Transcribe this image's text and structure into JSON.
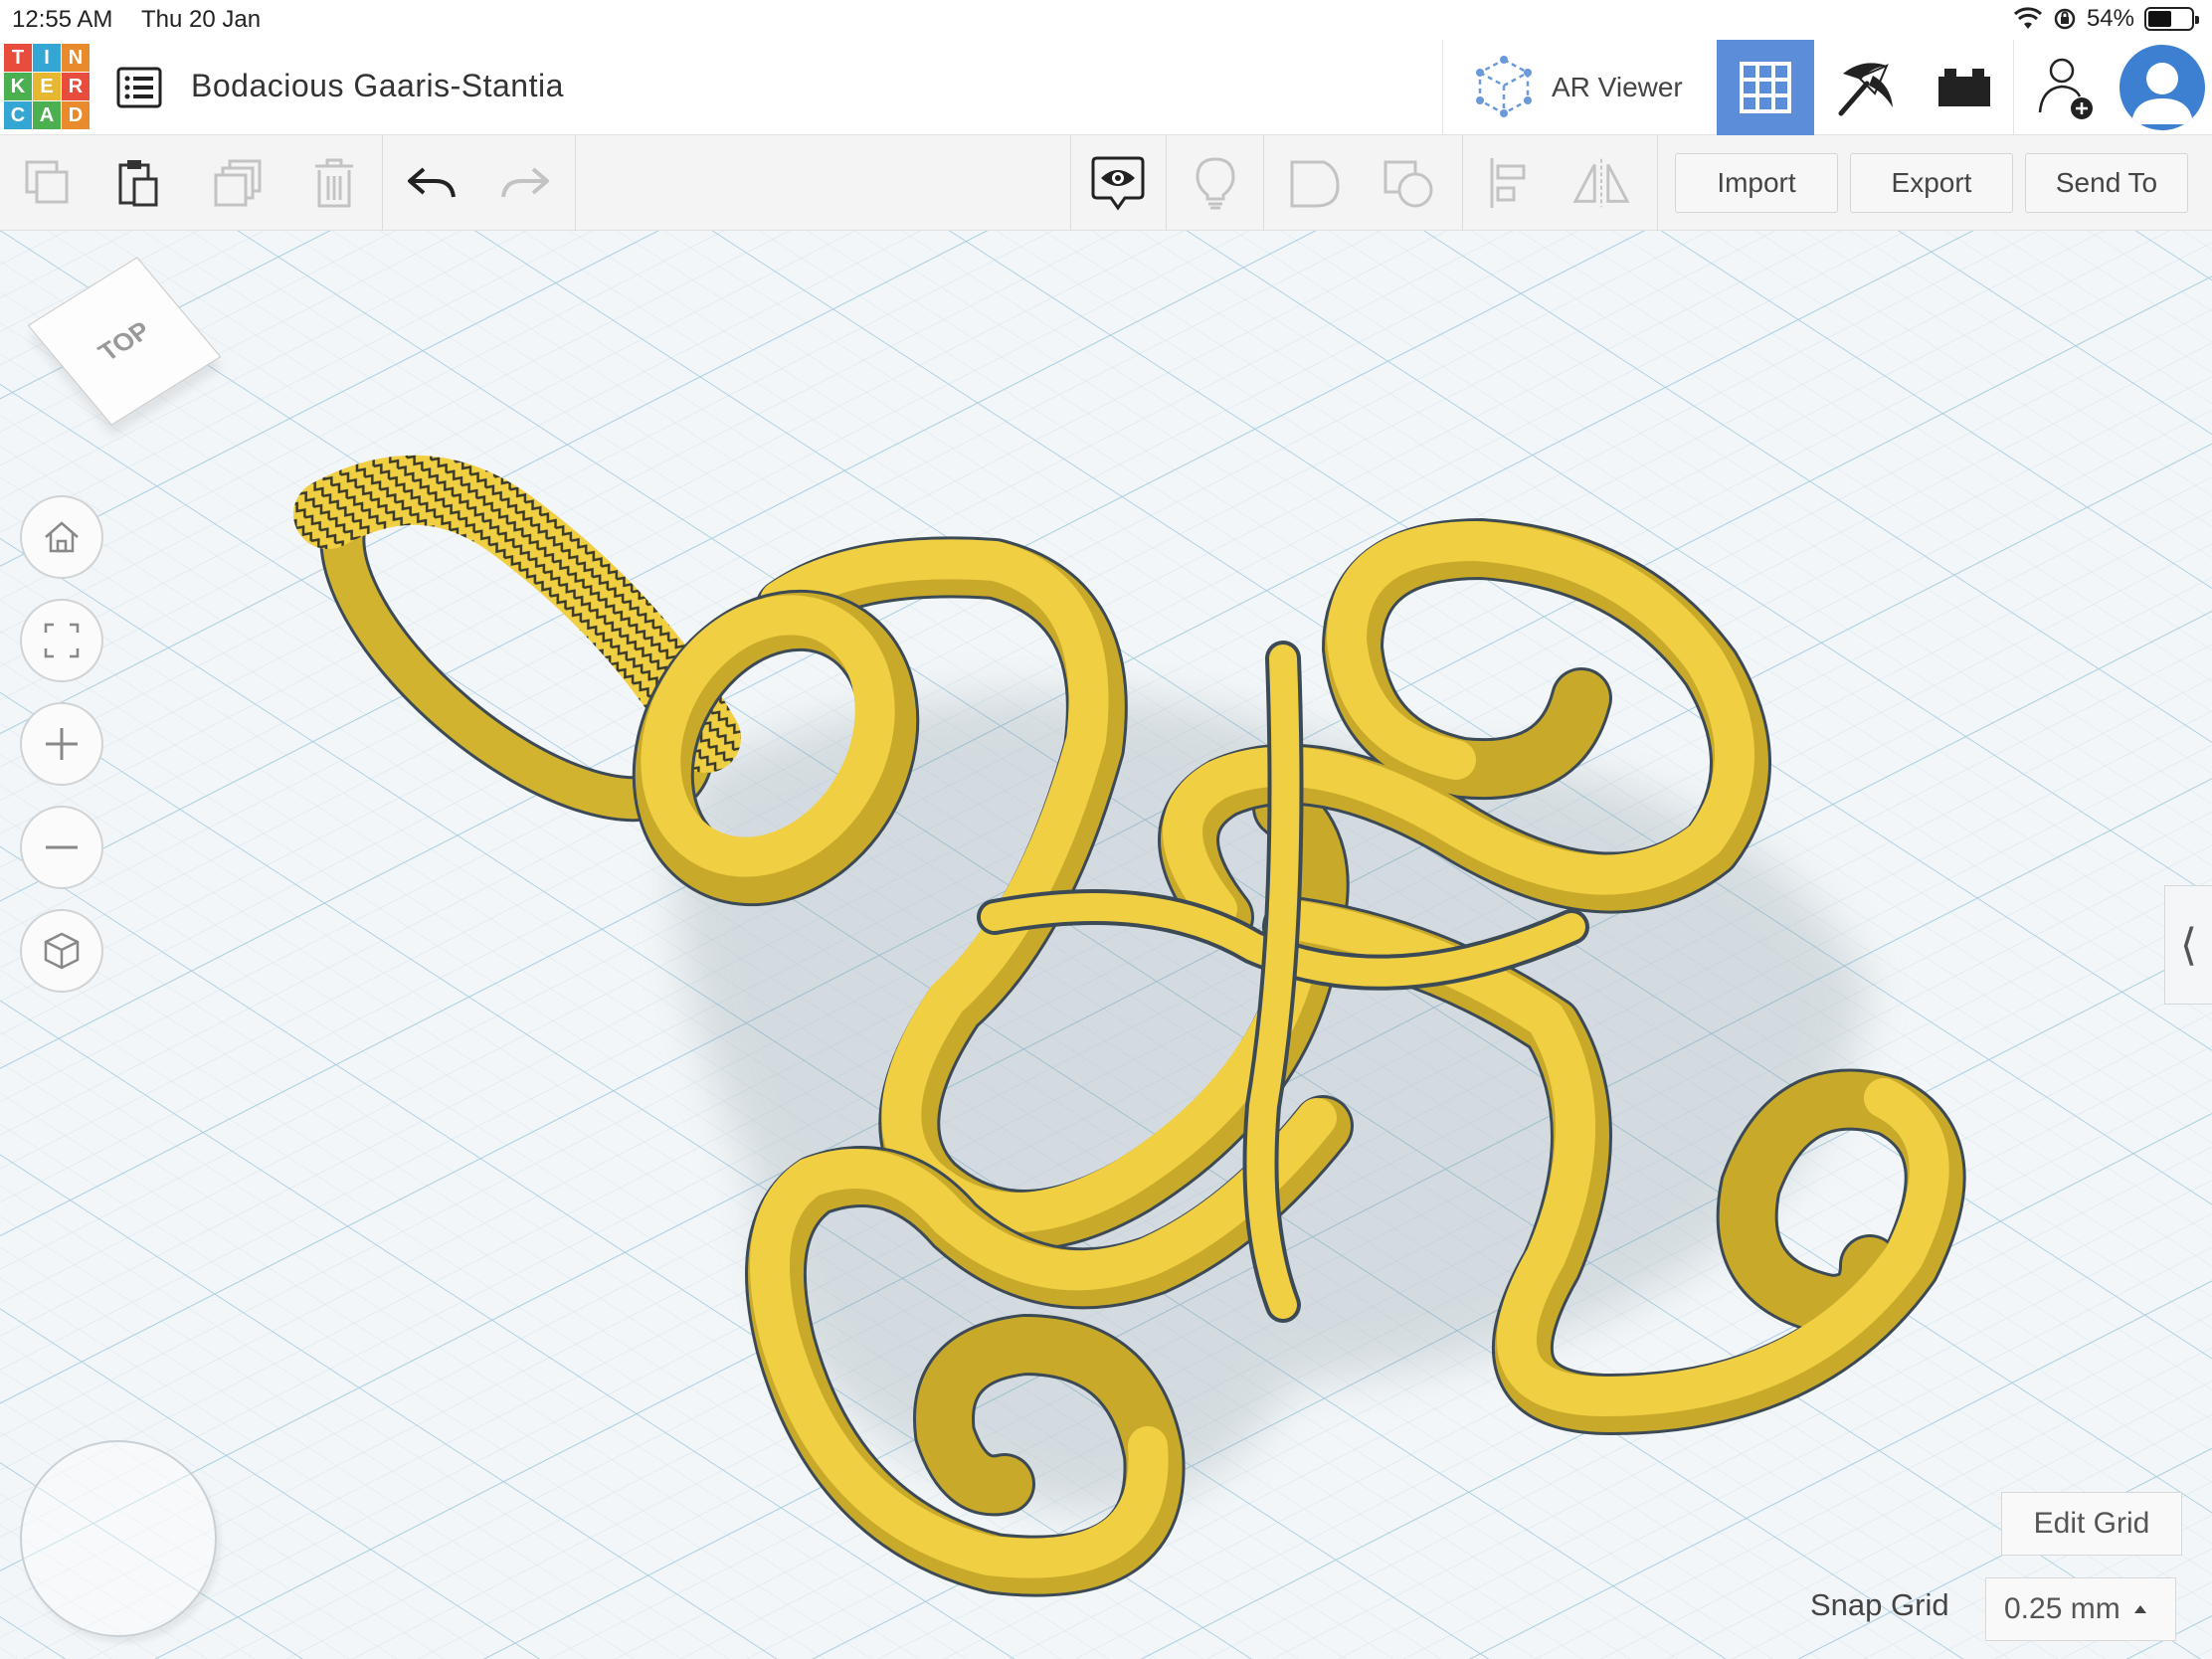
{
  "status_bar": {
    "time": "12:55 AM",
    "date": "Thu 20 Jan",
    "battery_text": "54%",
    "battery_level": 0.54
  },
  "header": {
    "logo_letters": [
      "T",
      "I",
      "N",
      "K",
      "E",
      "R",
      "C",
      "A",
      "D"
    ],
    "logo_colors": [
      "#e74c3c",
      "#33a6d4",
      "#e98a2d",
      "#4ab050",
      "#e6b832",
      "#e74c3c",
      "#33a6d4",
      "#4ab050",
      "#e98a2d"
    ],
    "project_title": "Bodacious Gaaris-Stantia",
    "ar_viewer_label": "AR Viewer",
    "accent_color": "#5b8dd9"
  },
  "toolbar": {
    "import_label": "Import",
    "export_label": "Export",
    "send_to_label": "Send To"
  },
  "canvas": {
    "view_cube_label": "TOP",
    "model_color": "#f0cf43",
    "edit_grid_label": "Edit Grid",
    "snap_grid_label": "Snap Grid",
    "snap_grid_value": "0.25 mm"
  }
}
